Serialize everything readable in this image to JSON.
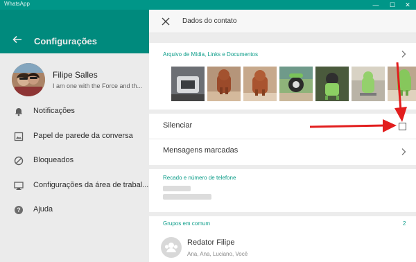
{
  "window": {
    "title": "WhatsApp",
    "controls": {
      "minimize": "—",
      "maximize": "☐",
      "close": "✕"
    }
  },
  "left_panel": {
    "header_title": "Configurações",
    "profile": {
      "name": "Filipe Salles",
      "status": "I am one with the Force and th..."
    },
    "menu": [
      {
        "label": "Notificações",
        "icon": "bell-icon"
      },
      {
        "label": "Papel de parede da conversa",
        "icon": "wallpaper-icon"
      },
      {
        "label": "Bloqueados",
        "icon": "block-icon"
      },
      {
        "label": "Configurações da área de trabal...",
        "icon": "desktop-icon"
      },
      {
        "label": "Ajuda",
        "icon": "help-icon"
      }
    ]
  },
  "right_panel": {
    "header_title": "Dados do contato",
    "media": {
      "title": "Arquivo de Mídia, Links e Documentos",
      "thumb_count": 7
    },
    "mute_label": "Silenciar",
    "starred_label": "Mensagens marcadas",
    "about": {
      "title": "Recado e número de telefone"
    },
    "groups": {
      "title": "Grupos em comum",
      "count": "2",
      "items": [
        {
          "name": "Redator Filipe",
          "members": "Ana, Ana, Luciano, Você"
        }
      ]
    }
  },
  "colors": {
    "accent": "#009688",
    "section_title": "#0a9c88",
    "arrow": "#e21d1d"
  }
}
